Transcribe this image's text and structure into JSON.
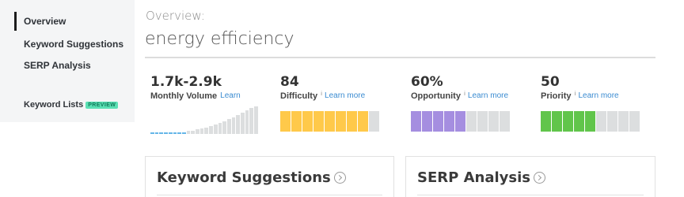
{
  "sidebar": {
    "items": [
      {
        "label": "Overview",
        "active": true
      },
      {
        "label": "Keyword Suggestions",
        "active": false
      },
      {
        "label": "SERP Analysis",
        "active": false
      }
    ],
    "keyword_lists": {
      "label": "Keyword Lists",
      "badge": "PREVIEW"
    }
  },
  "header": {
    "overview_label": "Overview:",
    "keyword": "energy efficiency"
  },
  "metrics": {
    "volume": {
      "value": "1.7k-2.9k",
      "label": "Monthly Volume",
      "learn": "Learn"
    },
    "difficulty": {
      "value": "84",
      "label": "Difficulty",
      "info": "i",
      "learn": "Learn more",
      "filled_segments": 8,
      "total_segments": 9,
      "color": "#ffc94a"
    },
    "opportunity": {
      "value": "60%",
      "label": "Opportunity",
      "info": "i",
      "learn": "Learn more",
      "filled_segments": 5,
      "total_segments": 9,
      "color": "#a58ee0"
    },
    "priority": {
      "value": "50",
      "label": "Priority",
      "info": "i",
      "learn": "Learn more",
      "filled_segments": 5,
      "total_segments": 9,
      "color": "#61c54b"
    }
  },
  "volume_chart": {
    "bar_levels": [
      0.05,
      0.05,
      0.05,
      0.05,
      0.05,
      0.05,
      0.05,
      0.05,
      0.1,
      0.12,
      0.15,
      0.18,
      0.22,
      0.27,
      0.32,
      0.38,
      0.44,
      0.5,
      0.57,
      0.64,
      0.72,
      0.8,
      0.88,
      0.95
    ],
    "highlighted_count": 8,
    "colors": {
      "highlight": "#65b6e8",
      "base": "#dcdedf"
    }
  },
  "cards": {
    "keyword_suggestions": {
      "title": "Keyword Suggestions"
    },
    "serp_analysis": {
      "title": "SERP Analysis"
    }
  }
}
